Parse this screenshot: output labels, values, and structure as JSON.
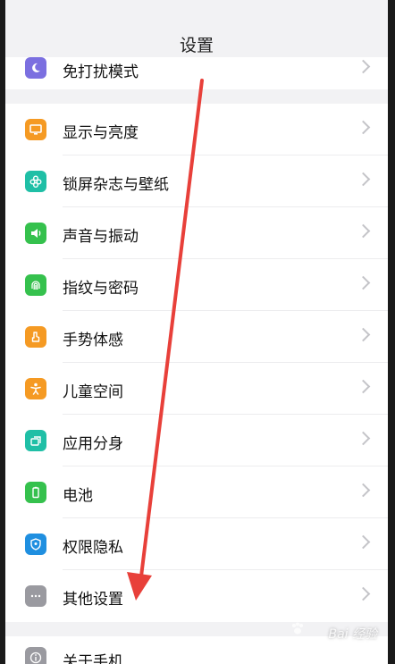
{
  "header": {
    "title": "设置"
  },
  "top_row": {
    "label": "免打扰模式",
    "icon": "moon-icon",
    "color": "#7b6fe0"
  },
  "items": [
    {
      "name": "display",
      "label": "显示与亮度",
      "icon": "monitor-icon",
      "color": "#f59a23"
    },
    {
      "name": "lockscreen",
      "label": "锁屏杂志与壁纸",
      "icon": "flower-icon",
      "color": "#1fbfa6"
    },
    {
      "name": "sound",
      "label": "声音与振动",
      "icon": "speaker-icon",
      "color": "#35c14d"
    },
    {
      "name": "fingerprint",
      "label": "指纹与密码",
      "icon": "fingerprint-icon",
      "color": "#35c14d"
    },
    {
      "name": "gesture",
      "label": "手势体感",
      "icon": "hand-icon",
      "color": "#f59a23"
    },
    {
      "name": "kids",
      "label": "儿童空间",
      "icon": "child-icon",
      "color": "#f59a23"
    },
    {
      "name": "clone",
      "label": "应用分身",
      "icon": "clone-icon",
      "color": "#1fbfa6"
    },
    {
      "name": "battery",
      "label": "电池",
      "icon": "battery-icon",
      "color": "#35c14d"
    },
    {
      "name": "privacy",
      "label": "权限隐私",
      "icon": "shield-icon",
      "color": "#1f8fe0"
    },
    {
      "name": "other",
      "label": "其他设置",
      "icon": "more-icon",
      "color": "#9a9aa0"
    }
  ],
  "bottom_row": {
    "label": "关于手机",
    "icon": "info-icon",
    "color": "#9a9aa0"
  },
  "annotation": {
    "color": "#e8403a"
  },
  "watermark": {
    "text": "Bai 经验"
  }
}
